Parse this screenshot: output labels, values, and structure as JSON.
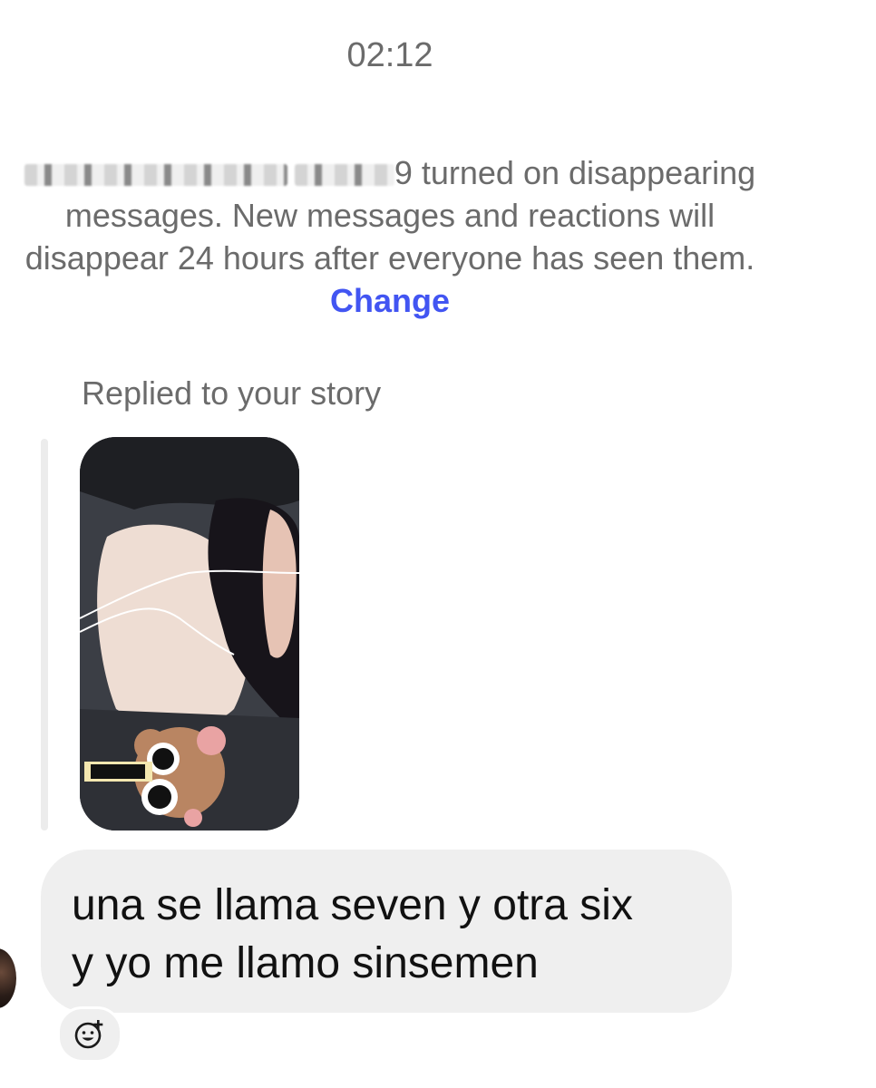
{
  "header": {
    "timestamp": "02:12"
  },
  "system_notice": {
    "username_visible_suffix": "9",
    "text": " turned on disappearing messages. New messages and reactions will disappear 24 hours after everyone has seen them. ",
    "link_label": "Change"
  },
  "story_reply": {
    "label": "Replied to your story",
    "thumbnail_icon": "story-photo"
  },
  "message": {
    "line1": "una se llama seven y otra six",
    "line2": "y yo me llamo sinsemen"
  },
  "reaction": {
    "icon": "add-reaction-smiley"
  },
  "colors": {
    "link": "#4255f2",
    "meta_text": "#6b6b6b",
    "bubble": "#efefef"
  }
}
